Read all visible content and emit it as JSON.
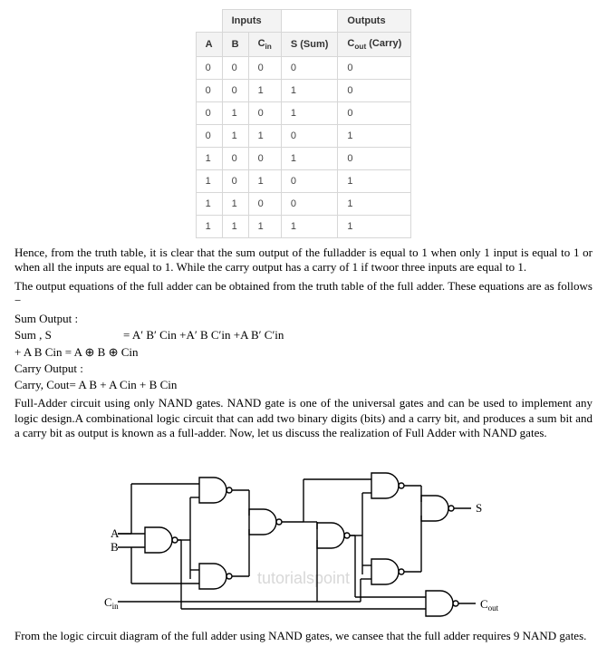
{
  "table": {
    "group_inputs": "Inputs",
    "group_outputs": "Outputs",
    "h_a": "A",
    "h_b": "B",
    "h_cin": "C",
    "h_cin_sub": "in",
    "h_s": "S (Sum)",
    "h_cout": "C",
    "h_cout_sub": "out",
    "h_cout_tail": " (Carry)",
    "rows": [
      {
        "a": "0",
        "b": "0",
        "cin": "0",
        "s": "0",
        "cout": "0"
      },
      {
        "a": "0",
        "b": "0",
        "cin": "1",
        "s": "1",
        "cout": "0"
      },
      {
        "a": "0",
        "b": "1",
        "cin": "0",
        "s": "1",
        "cout": "0"
      },
      {
        "a": "0",
        "b": "1",
        "cin": "1",
        "s": "0",
        "cout": "1"
      },
      {
        "a": "1",
        "b": "0",
        "cin": "0",
        "s": "1",
        "cout": "0"
      },
      {
        "a": "1",
        "b": "0",
        "cin": "1",
        "s": "0",
        "cout": "1"
      },
      {
        "a": "1",
        "b": "1",
        "cin": "0",
        "s": "0",
        "cout": "1"
      },
      {
        "a": "1",
        "b": "1",
        "cin": "1",
        "s": "1",
        "cout": "1"
      }
    ]
  },
  "text": {
    "p1": "Hence, from the truth table, it is clear that the sum output of the fulladder is equal to 1 when only 1 input is equal to 1 or when all the inputs are equal to 1. While the carry output has a carry of 1 if twoor three inputs are equal to 1.",
    "p2": "The output equations of the full adder can be obtained from the truth table of the full adder. These equations are as follows −",
    "sum_hdr": "Sum Output :",
    "sum_lhs": "Sum , S",
    "sum_rhs": "= A′ B′ Cin +A′ B C′in +A B′ C′in",
    "sum2": "+ A B Cin = A ⊕ B ⊕ Cin",
    "carry_hdr": "Carry Output :",
    "carry_eq": "Carry, Cout= A B + A Cin + B Cin",
    "p3": "Full-Adder circuit using only NAND gates. NAND gate is one of the universal gates and can be used to implement any logic design.A combinational logic circuit that can add two binary digits (bits) and a carry bit, and produces a sum bit and a carry bit as output is known as a full-adder. Now, let us discuss the realization of Full Adder with NAND gates.",
    "p4": "From the logic circuit diagram of the full adder using NAND gates, we cansee that the full adder requires 9 NAND gates."
  },
  "diagram": {
    "lbl_a": "A",
    "lbl_b": "B",
    "lbl_cin": "C",
    "lbl_cin_sub": "in",
    "lbl_s": "S",
    "lbl_cout": "C",
    "lbl_cout_sub": "out",
    "watermark": "tutorialspoint"
  }
}
